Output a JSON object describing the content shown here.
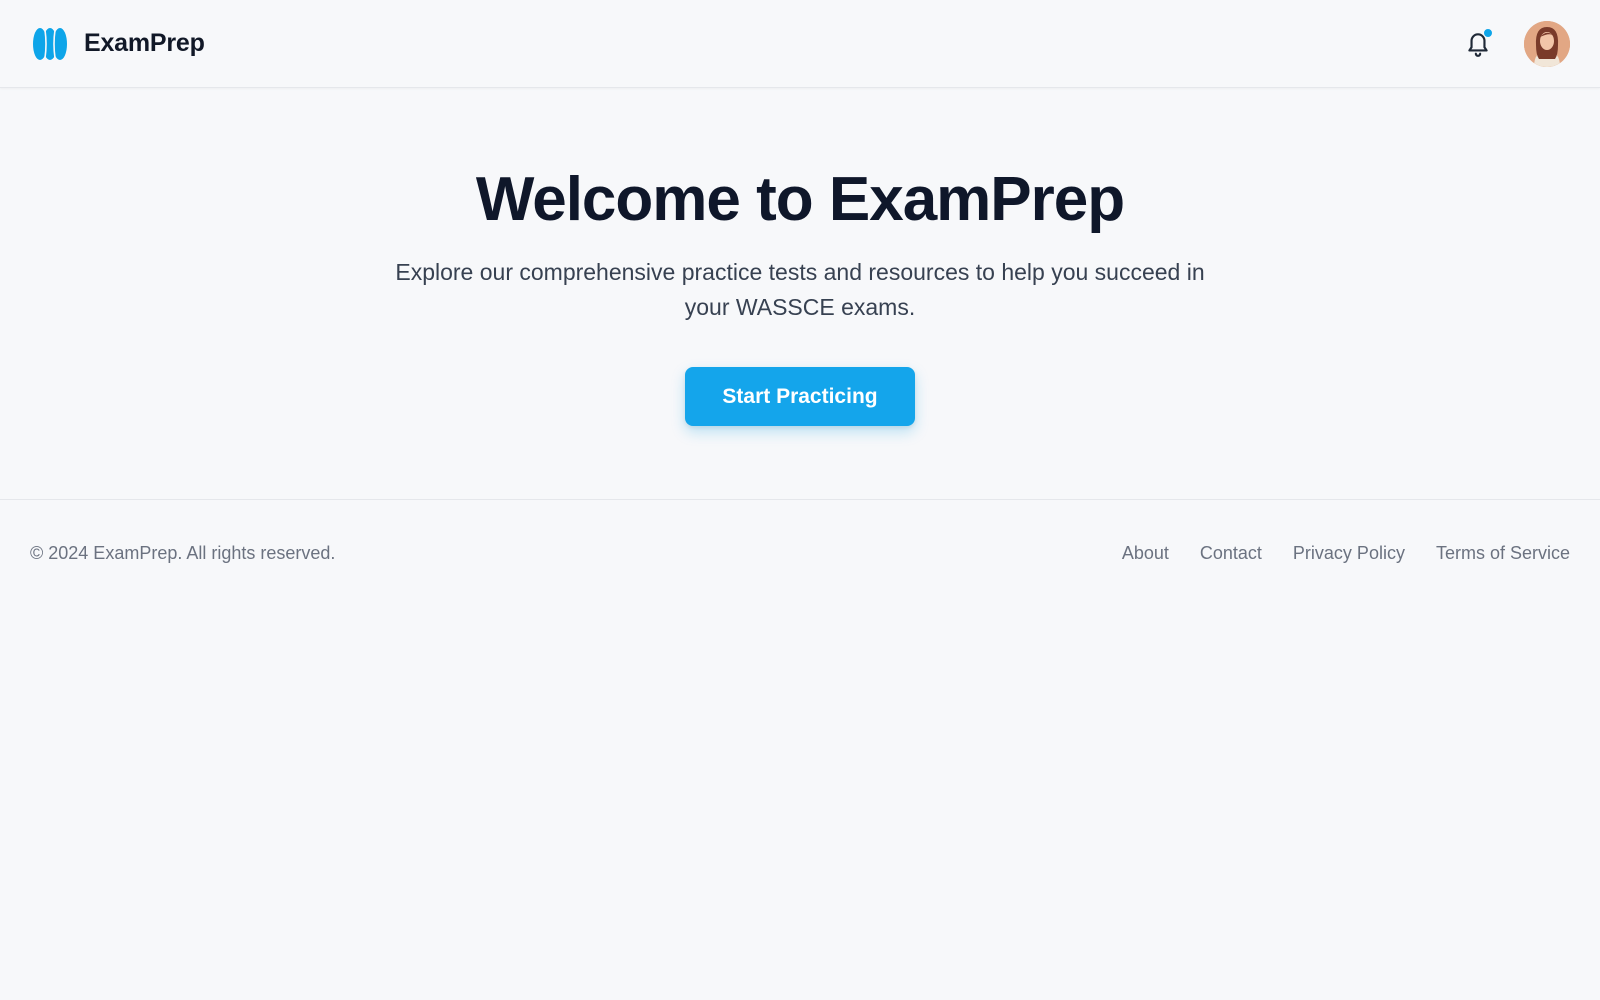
{
  "header": {
    "brand_name": "ExamPrep",
    "logo_icon": "waves-logo",
    "notification_icon": "bell-icon",
    "has_unread_notifications": true,
    "accent_color": "#0ea5e9",
    "avatar_icon": "user-avatar"
  },
  "hero": {
    "title": "Welcome to ExamPrep",
    "subtitle": "Explore our comprehensive practice tests and resources to help you succeed in your WASSCE exams.",
    "cta_label": "Start Practicing",
    "cta_color": "#14a5eb"
  },
  "footer": {
    "copyright": "© 2024 ExamPrep. All rights reserved.",
    "links": [
      {
        "label": "About"
      },
      {
        "label": "Contact"
      },
      {
        "label": "Privacy Policy"
      },
      {
        "label": "Terms of Service"
      }
    ]
  }
}
